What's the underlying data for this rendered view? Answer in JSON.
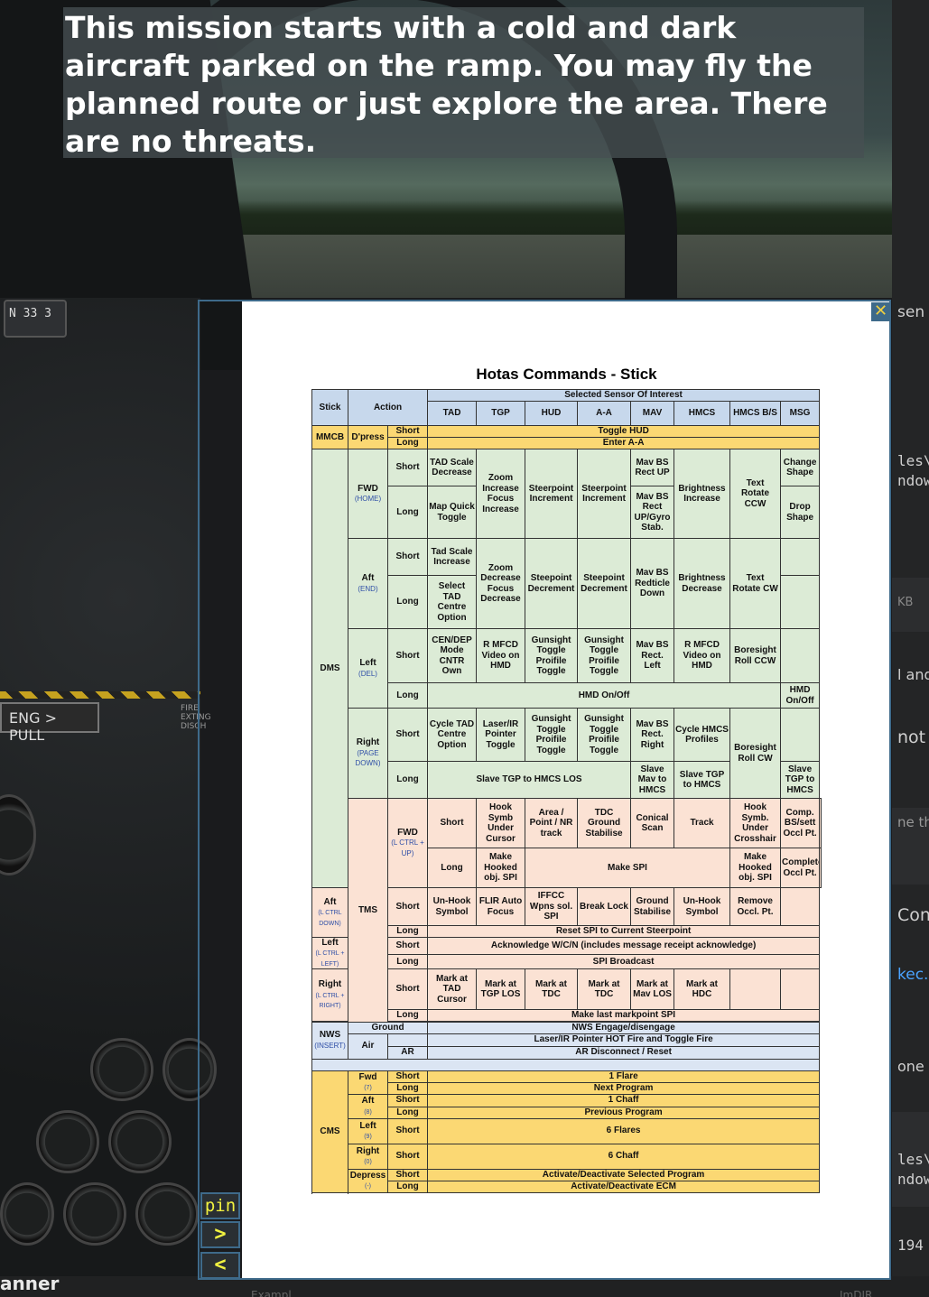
{
  "briefing": {
    "text": "This mission starts with a cold and dark aircraft parked on the ramp.  You may fly the planned route or just explore the area.  There are no threats."
  },
  "cockpit": {
    "compass_label": "N 33 3",
    "pull_label": "ENG > PULL",
    "fire_label": "FIRE EXTING DISCH"
  },
  "viewer": {
    "close_label": "✕",
    "pin_label": "pin",
    "next_label": ">",
    "prev_label": "<"
  },
  "right_panel": {
    "t1": "sen",
    "t2": "les\\",
    "t3": "ndow",
    "t4": "KB ",
    "t5": "l and",
    "t6": "not b",
    "t7": "ne tha",
    "t8": "Confi",
    "t9": "kec.c",
    "t10": "one",
    "t11": "les\\",
    "t12": "ndow",
    "t13": "194"
  },
  "bottom": {
    "left_text": "anner",
    "link_text": "Exampl",
    "right_text": "ImDIR"
  },
  "doc": {
    "title": "Hotas Commands  - Stick",
    "h": {
      "stick": "Stick",
      "action": "Action",
      "sensor": "Selected Sensor Of Interest",
      "cols": [
        "TAD",
        "TGP",
        "HUD",
        "A-A",
        "MAV",
        "HMCS",
        "HMCS B/S",
        "MSG"
      ]
    },
    "mmcb": {
      "label": "MMCB",
      "dpress": "D'press",
      "short": "Short",
      "long": "Long",
      "short_val": "Toggle HUD",
      "long_val": "Enter A-A"
    },
    "dms": {
      "label": "DMS",
      "fwd": "FWD",
      "fwd_sub": "(HOME)",
      "aft": "Aft",
      "aft_sub": "(END)",
      "left": "Left",
      "left_sub": "(DEL)",
      "right": "Right",
      "right_sub": "(PAGE DOWN)",
      "short": "Short",
      "long": "Long",
      "fwd_s_tad": "TAD Scale Decrease",
      "fwd_tgp": "Zoom Increase Focus Increase",
      "fwd_hud": "Steerpoint Increment",
      "fwd_aa": "Steerpoint Increment",
      "fwd_s_mav": "Mav BS Rect UP",
      "fwd_hmcs": "Brightness Increase",
      "fwd_bs": "Text Rotate CCW",
      "fwd_s_msg": "Change Shape",
      "fwd_l_tad": "Map Quick Toggle",
      "fwd_l_mav": "Mav BS Rect UP/Gyro Stab.",
      "fwd_l_msg": "Drop Shape",
      "aft_s_tad": "Tad Scale Increase",
      "aft_tgp": "Zoom Decrease Focus Decrease",
      "aft_hud": "Steepoint Decrement",
      "aft_aa": "Steepoint Decrement",
      "aft_mav": "Mav BS Redticle Down",
      "aft_hmcs": "Brightness Decrease",
      "aft_bs": "Text Rotate CW",
      "aft_l_tad": "Select TAD Centre Option",
      "left_s_tad": "CEN/DEP Mode CNTR Own",
      "left_s_tgp": "R MFCD Video on HMD",
      "left_s_hud": "Gunsight Toggle Proifile Toggle",
      "left_s_aa": "Gunsight Toggle Proifile Toggle",
      "left_s_mav": "Mav BS Rect. Left",
      "left_s_hmcs": "R MFCD Video on HMD",
      "left_bs": "Boresight Roll CCW",
      "left_l": "HMD On/Off",
      "left_l_msg": "HMD On/Off",
      "right_s_tad": "Cycle TAD Centre Option",
      "right_s_tgp": "Laser/IR Pointer Toggle",
      "right_s_hud": "Gunsight Toggle Proifile Toggle",
      "right_s_aa": "Gunsight Toggle Proifile Toggle",
      "right_s_mav": "Mav BS Rect. Right",
      "right_s_hmcs": "Cycle HMCS Profiles",
      "right_bs": "Boresight Roll CW",
      "right_l": "Slave TGP to HMCS LOS",
      "right_l_mav": "Slave Mav to HMCS",
      "right_l_hmcs": "Slave TGP to HMCS",
      "right_l_msg": "Slave TGP to HMCS"
    },
    "tms": {
      "label": "TMS",
      "fwd": "FWD",
      "fwd_sub": "(L CTRL + UP)",
      "aft": "Aft",
      "aft_sub": "(L CTRL DOWN)",
      "left": "Left",
      "left_sub": "(L CTRL + LEFT)",
      "right": "Right",
      "right_sub": "(L CTRL + RIGHT)",
      "short": "Short",
      "long": "Long",
      "fwd_s_tad": "Hook Symb Under Cursor",
      "fwd_s_tgp": "Area / Point / NR track",
      "fwd_s_hud": "TDC Ground Stabilise",
      "fwd_s_aa": "Conical Scan",
      "fwd_s_mav": "Track",
      "fwd_s_hmcs": "Hook Symb. Under Crosshair",
      "fwd_s_bs": "Comp. BS/sett Occl Pt.",
      "fwd_l_tad": "Make Hooked obj. SPI",
      "fwd_l_mid": "Make SPI",
      "fwd_l_hmcs": "Make Hooked obj. SPI",
      "fwd_l_bs": "Complete Occl Pt.",
      "aft_s_tad": "Un-Hook Symbol",
      "aft_s_tgp": "FLIR Auto Focus",
      "aft_s_hud": "IFFCC Wpns sol. SPI",
      "aft_s_aa": "Break Lock",
      "aft_s_mav": "Ground Stabilise",
      "aft_s_hmcs": "Un-Hook Symbol",
      "aft_s_bs": "Remove Occl. Pt.",
      "aft_l": "Reset SPI to Current Steerpoint",
      "left_s": "Acknowledge W/C/N (includes message receipt acknowledge)",
      "left_l": "SPI Broadcast",
      "right_s_tad": "Mark at TAD Cursor",
      "right_s_tgp": "Mark at TGP LOS",
      "right_s_hud": "Mark at TDC",
      "right_s_aa": "Mark at TDC",
      "right_s_mav": "Mark at Mav LOS",
      "right_s_hmcs": "Mark at HDC",
      "right_l": "Make last markpoint SPI"
    },
    "nws": {
      "label": "NWS",
      "sub": "(INSERT)",
      "ground": "Ground",
      "air": "Air",
      "ar": "AR",
      "ground_val": "NWS Engage/disengage",
      "air_val": "Laser/IR Pointer HOT Fire and Toggle Fire",
      "ar_val": "AR Disconnect / Reset"
    },
    "cms": {
      "label": "CMS",
      "fwd": "Fwd",
      "fwd_sub": "(7)",
      "aft": "Aft",
      "aft_sub": "(8)",
      "left": "Left",
      "left_sub": "(9)",
      "right": "Right",
      "right_sub": "(0)",
      "depress": "Depress",
      "depress_sub": "(-)",
      "short": "Short",
      "long": "Long",
      "fwd_s": "1 Flare",
      "fwd_l": "Next Program",
      "aft_s": "1 Chaff",
      "aft_l": "Previous Program",
      "left_s": "6 Flares",
      "right_s": "6 Chaff",
      "dep_s": "Activate/Deactivate Selected Program",
      "dep_l": "Activate/Deactivate ECM"
    }
  }
}
